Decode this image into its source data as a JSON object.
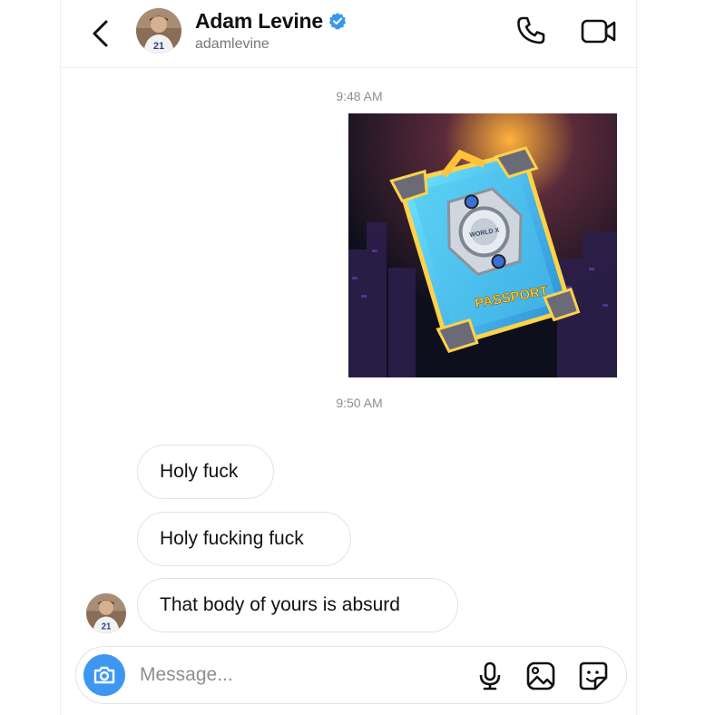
{
  "header": {
    "name": "Adam Levine",
    "handle": "adamlevine",
    "verified": true,
    "avatar_jersey_number": "21",
    "icons": [
      "back-chevron-icon",
      "verified-badge-icon",
      "phone-icon",
      "video-icon"
    ]
  },
  "thread": {
    "timestamps": [
      "9:48 AM",
      "9:50 AM"
    ],
    "shared_image": {
      "logo_text": "WORLD X",
      "card_text": "PASSPORT"
    },
    "messages": [
      {
        "text": "Holy fuck"
      },
      {
        "text": "Holy fucking fuck"
      },
      {
        "text": "That body of yours is absurd"
      }
    ]
  },
  "composer": {
    "placeholder": "Message...",
    "icons": [
      "camera-icon",
      "microphone-icon",
      "gallery-icon",
      "sticker-icon"
    ]
  },
  "colors": {
    "verified_blue": "#3897f0",
    "camera_button": "#3d97f0",
    "muted_text": "#8e8e8e",
    "bubble_border": "#e3e3e3"
  }
}
